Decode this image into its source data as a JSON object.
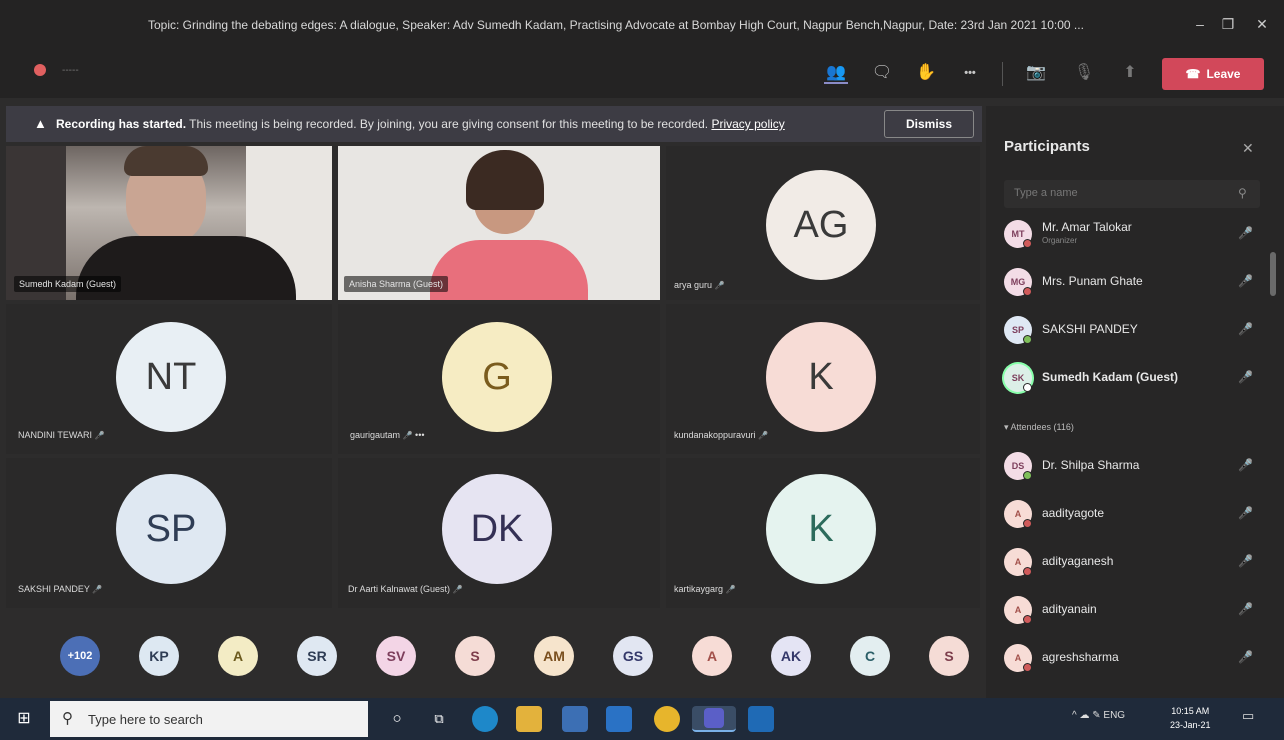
{
  "window": {
    "title": "Topic: Grinding the debating edges: A dialogue, Speaker: Adv Sumedh Kadam, Practising Advocate at Bombay High Court, Nagpur Bench,Nagpur, Date: 23rd Jan 2021 10:00 ...",
    "minimize": "–",
    "maximize": "❐",
    "close": "✕"
  },
  "toolbar": {
    "timer": "-----",
    "participants_icon": "👥",
    "chat_icon": "🗨",
    "raise_hand_icon": "✋",
    "more_icon": "•••",
    "camera_icon": "📷",
    "mic_icon": "🎙",
    "share_icon": "⬆",
    "leave_label": "Leave",
    "leave_phone_icon": "☎"
  },
  "banner": {
    "icon": "▲",
    "bold": "Recording has started.",
    "text": " This meeting is being recorded. By joining, you are giving consent for this meeting to be recorded. ",
    "link": "Privacy policy",
    "dismiss": "Dismiss"
  },
  "tiles": {
    "t1": {
      "name": "Sumedh Kadam (Guest)"
    },
    "t2": {
      "name": "Anisha Sharma (Guest)"
    },
    "t3": {
      "initials": "AG",
      "name": "arya guru",
      "mic": "🎤"
    },
    "t4": {
      "initials": "NT",
      "name": "NANDINI TEWARI",
      "mic": "🎤"
    },
    "t5": {
      "initials": "G",
      "name": "gaurigautam",
      "mic": "🎤",
      "more": "•••"
    },
    "t6": {
      "initials": "K",
      "name": "kundanakoppuravuri",
      "mic": "🎤"
    },
    "t7": {
      "initials": "SP",
      "name": "SAKSHI PANDEY",
      "mic": "🎤"
    },
    "t8": {
      "initials": "DK",
      "name": "Dr Aarti Kalnawat (Guest)",
      "mic": "🎤"
    },
    "t9": {
      "initials": "K",
      "name": "kartikaygarg",
      "mic": "🎤"
    }
  },
  "strip": [
    "+102",
    "KP",
    "A",
    "SR",
    "SV",
    "S",
    "AM",
    "GS",
    "A",
    "AK",
    "C",
    "S"
  ],
  "panel": {
    "title": "Participants",
    "close_icon": "✕",
    "search_placeholder": "Type a name",
    "search_icon": "⚲",
    "presenters": [
      {
        "initials": "MT",
        "name": "Mr. Amar Talokar",
        "role": "Organizer",
        "mic": "🎤"
      },
      {
        "initials": "MG",
        "name": "Mrs. Punam Ghate",
        "role": "",
        "mic": "🎤"
      },
      {
        "initials": "SP",
        "name": "SAKSHI PANDEY",
        "role": "",
        "mic": "🎤"
      },
      {
        "initials": "SK",
        "name": "Sumedh Kadam (Guest)",
        "role": "",
        "mic": "🎤"
      }
    ],
    "attendees_label": "▾ Attendees (116)",
    "attendees": [
      {
        "initials": "DS",
        "name": "Dr. Shilpa Sharma",
        "mic": "🎤"
      },
      {
        "initials": "A",
        "name": "aadityagote",
        "mic": "🎤"
      },
      {
        "initials": "A",
        "name": "adityaganesh",
        "mic": "🎤"
      },
      {
        "initials": "A",
        "name": "adityanain",
        "mic": "🎤"
      },
      {
        "initials": "A",
        "name": "agreshsharma",
        "mic": "🎤"
      }
    ]
  },
  "taskbar": {
    "start_icon": "⊞",
    "search_icon": "⚲",
    "search_placeholder": "Type here to search",
    "cortana_icon": "○",
    "taskview_icon": "⧉",
    "tray_text": "^  ☁  ✎  ENG",
    "time": "10:15 AM",
    "date": "23-Jan-21",
    "notif_icon": "▭"
  },
  "colors": {
    "leave": "#d2485a",
    "app_bg": "#2d2c2c",
    "taskbar": "#1f2a3a"
  }
}
